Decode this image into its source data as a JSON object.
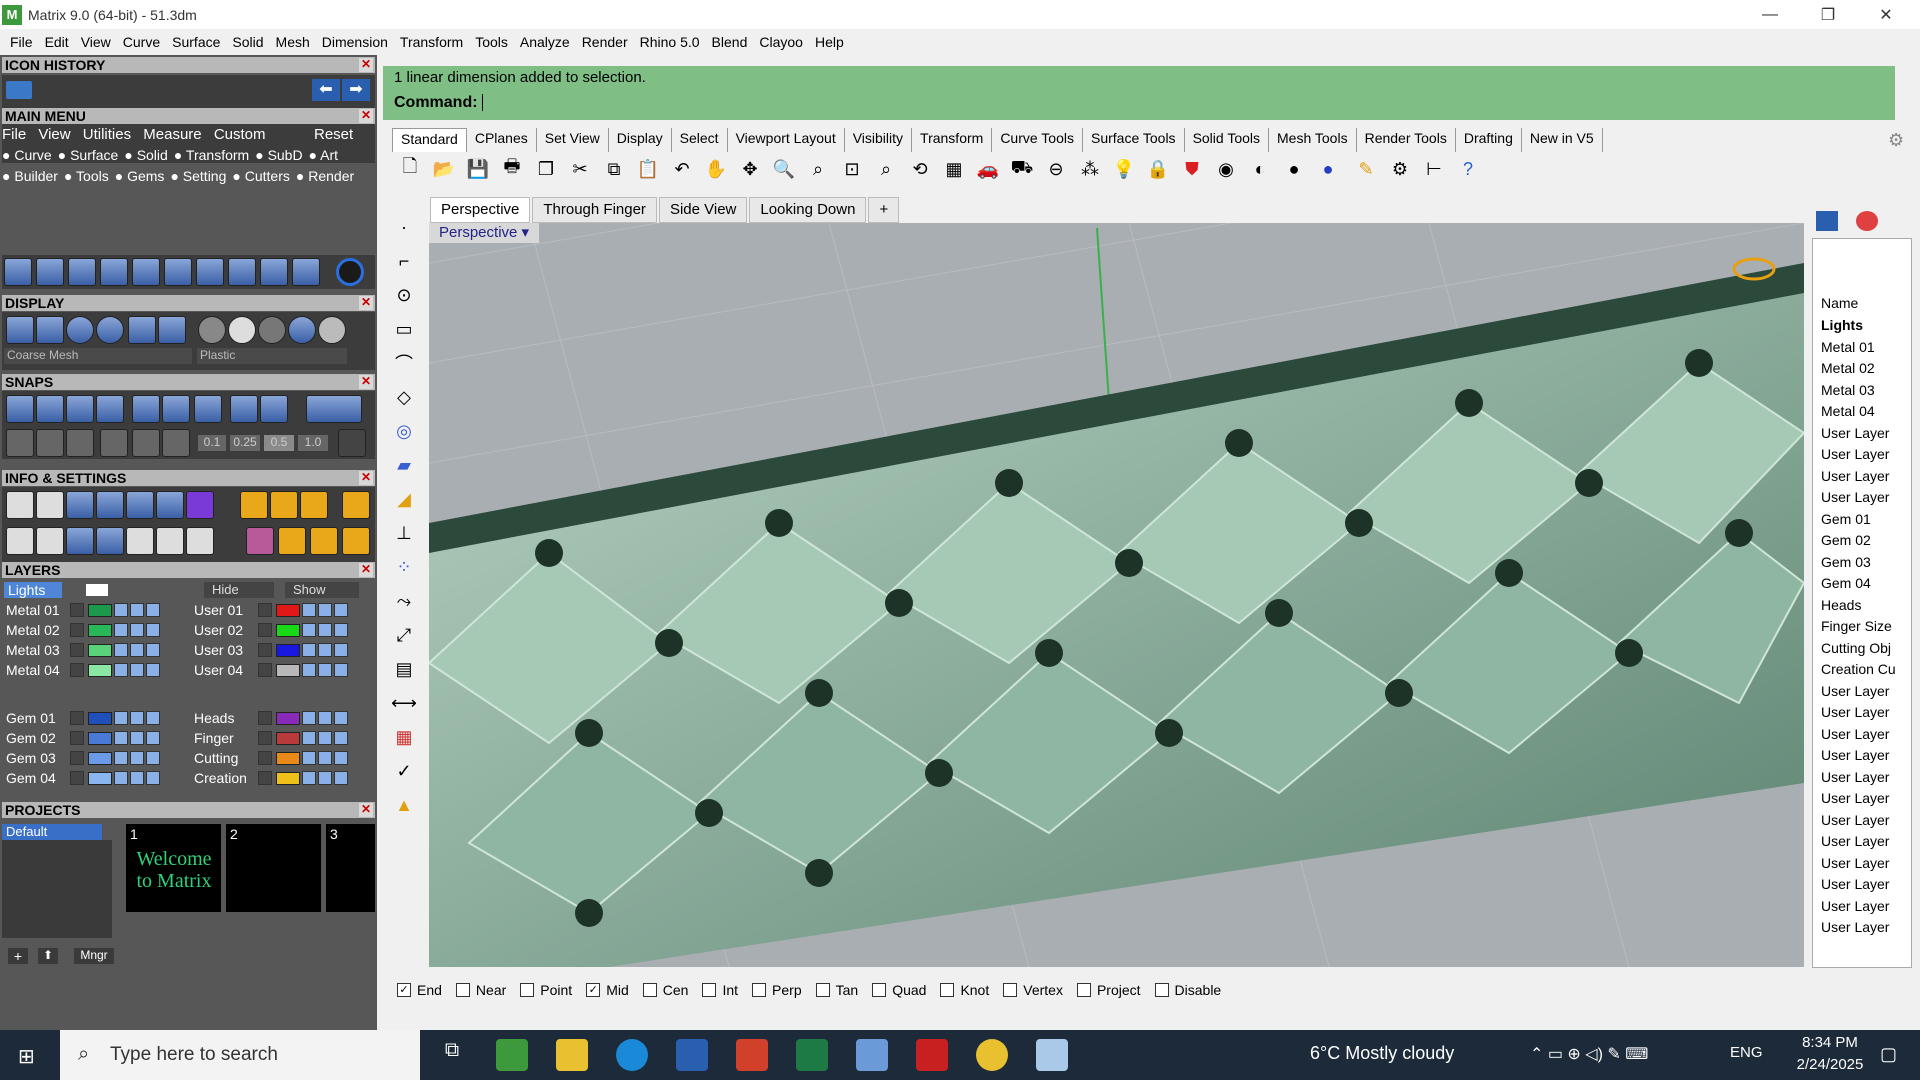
{
  "window": {
    "title": "Matrix 9.0 (64-bit) - 51.3dm",
    "min": "—",
    "restore": "❐",
    "close": "✕"
  },
  "menu": [
    "File",
    "Edit",
    "View",
    "Curve",
    "Surface",
    "Solid",
    "Mesh",
    "Dimension",
    "Transform",
    "Tools",
    "Analyze",
    "Render",
    "Rhino 5.0",
    "Blend",
    "Clayoo",
    "Help"
  ],
  "left": {
    "icon_history": "ICON HISTORY",
    "main_menu": "MAIN MENU",
    "main_menu_items": [
      "File",
      "View",
      "Utilities",
      "Measure",
      "Custom"
    ],
    "reset": "Reset",
    "mm_row1": [
      "Curve",
      "Surface",
      "Solid",
      "Transform",
      "SubD",
      "Art"
    ],
    "mm_row2": [
      "Builder",
      "Tools",
      "Gems",
      "Setting",
      "Cutters",
      "Render"
    ],
    "display": "DISPLAY",
    "mesh_select": "Coarse Mesh",
    "material_select": "Plastic",
    "snaps": "SNAPS",
    "snap_vals": [
      "0.1",
      "0.25",
      "0.5",
      "1.0"
    ],
    "info": "INFO & SETTINGS",
    "layers": "LAYERS",
    "hide": "Hide",
    "show": "Show",
    "lights": "Lights",
    "layers_left": [
      {
        "name": "Metal 01",
        "color": "#1a9a4a"
      },
      {
        "name": "Metal 02",
        "color": "#28b85a"
      },
      {
        "name": "Metal 03",
        "color": "#5ad27a"
      },
      {
        "name": "Metal 04",
        "color": "#8ae6a2"
      },
      {
        "name": "Gem 01",
        "color": "#1f4fb8"
      },
      {
        "name": "Gem 02",
        "color": "#4a7ad8"
      },
      {
        "name": "Gem 03",
        "color": "#6a9ae8"
      },
      {
        "name": "Gem 04",
        "color": "#8ab6f0"
      }
    ],
    "layers_right": [
      {
        "name": "User 01",
        "color": "#e01818"
      },
      {
        "name": "User 02",
        "color": "#18d818"
      },
      {
        "name": "User 03",
        "color": "#1818e0"
      },
      {
        "name": "User 04",
        "color": "#b8b8b8"
      },
      {
        "name": "Heads",
        "color": "#8a2ab8"
      },
      {
        "name": "Finger",
        "color": "#b83a3a"
      },
      {
        "name": "Cutting",
        "color": "#e88a1a"
      },
      {
        "name": "Creation",
        "color": "#f0c01a"
      }
    ],
    "projects": "PROJECTS",
    "project_default": "Default",
    "proj_nums": [
      "1",
      "2",
      "3"
    ],
    "proj_welcome": "Welcome to Matrix",
    "mngr": "Mngr"
  },
  "cmd": {
    "line1": "1 linear dimension added to selection.",
    "line2": "Command:"
  },
  "tabs": [
    "Standard",
    "CPlanes",
    "Set View",
    "Display",
    "Select",
    "Viewport Layout",
    "Visibility",
    "Transform",
    "Curve Tools",
    "Surface Tools",
    "Solid Tools",
    "Mesh Tools",
    "Render Tools",
    "Drafting",
    "New in V5"
  ],
  "viewport_tabs": [
    "Perspective",
    "Through Finger",
    "Side View",
    "Looking Down"
  ],
  "viewport_label": "Perspective",
  "right_panel": {
    "header": "Name",
    "items": [
      "Lights",
      "Metal 01",
      "Metal 02",
      "Metal 03",
      "Metal 04",
      "User Layer",
      "User Layer",
      "User Layer",
      "User Layer",
      "Gem 01",
      "Gem 02",
      "Gem 03",
      "Gem 04",
      "Heads",
      "Finger Size",
      "Cutting Obj",
      "Creation Cu",
      "User Layer",
      "User Layer",
      "User Layer",
      "User Layer",
      "User Layer",
      "User Layer",
      "User Layer",
      "User Layer",
      "User Layer",
      "User Layer",
      "User Layer",
      "User Layer"
    ]
  },
  "snaps_bar": [
    {
      "label": "End",
      "checked": true
    },
    {
      "label": "Near",
      "checked": false
    },
    {
      "label": "Point",
      "checked": false
    },
    {
      "label": "Mid",
      "checked": true
    },
    {
      "label": "Cen",
      "checked": false
    },
    {
      "label": "Int",
      "checked": false
    },
    {
      "label": "Perp",
      "checked": false
    },
    {
      "label": "Tan",
      "checked": false
    },
    {
      "label": "Quad",
      "checked": false
    },
    {
      "label": "Knot",
      "checked": false
    },
    {
      "label": "Vertex",
      "checked": false
    },
    {
      "label": "Project",
      "checked": false
    },
    {
      "label": "Disable",
      "checked": false
    }
  ],
  "taskbar": {
    "search_placeholder": "Type here to search",
    "weather": "6°C Mostly cloudy",
    "lang": "ENG",
    "time": "8:34 PM",
    "date": "2/24/2025"
  },
  "colors": {
    "cmd_green": "#7fbf86",
    "model_green": "#6a8f7c",
    "panel_gray": "#575757"
  }
}
